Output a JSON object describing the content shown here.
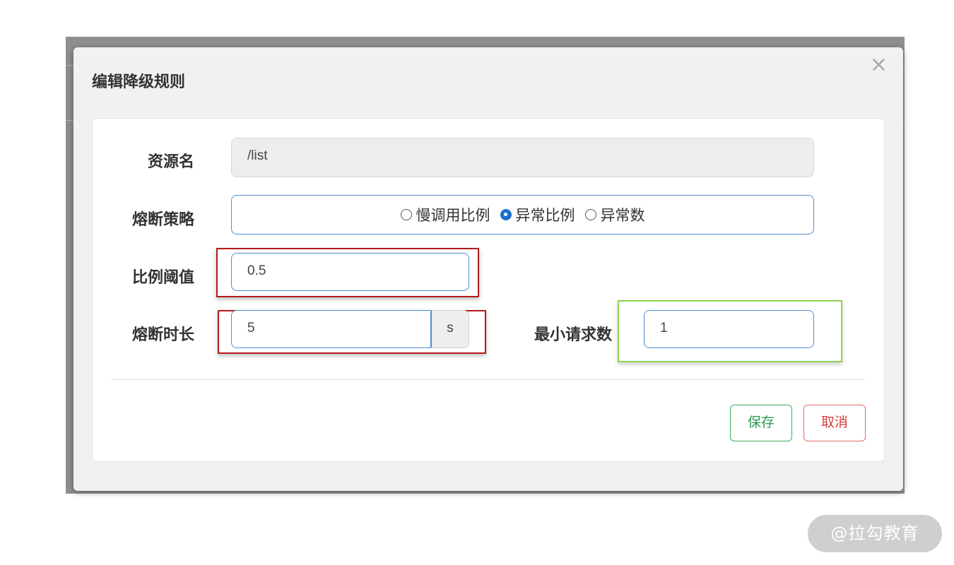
{
  "dialog": {
    "title": "编辑降级规则",
    "close_glyph": "×"
  },
  "form": {
    "resource": {
      "label": "资源名",
      "value": "/list"
    },
    "strategy": {
      "label": "熔断策略",
      "options": [
        {
          "label": "慢调用比例",
          "checked": false
        },
        {
          "label": "异常比例",
          "checked": true
        },
        {
          "label": "异常数",
          "checked": false
        }
      ]
    },
    "ratio_threshold": {
      "label": "比例阈值",
      "value": "0.5"
    },
    "break_duration": {
      "label": "熔断时长",
      "value": "5",
      "unit": "s"
    },
    "min_requests": {
      "label": "最小请求数",
      "value": "1"
    }
  },
  "buttons": {
    "save": "保存",
    "cancel": "取消"
  },
  "watermark": "@拉勾教育",
  "colors": {
    "accent_blue": "#4f8fd0",
    "save_green": "#2b9a48",
    "cancel_red": "#d63c3c",
    "highlight_red": "#b31b1b",
    "highlight_green": "#8fd14f"
  }
}
